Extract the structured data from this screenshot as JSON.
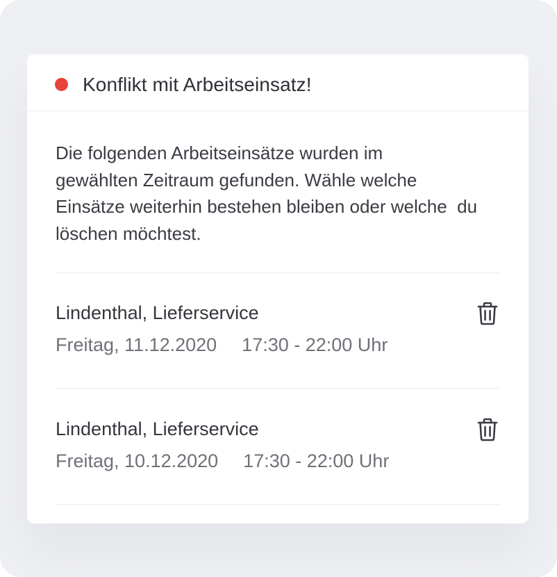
{
  "dialog": {
    "title": "Konflikt mit Arbeitseinsatz!",
    "status_color": "#e8443a",
    "intro": "Die folgenden Arbeitseinsätze wurden im\ngewählten Zeitraum gefunden. Wähle welche\nEinsätze weiterhin bestehen bleiben oder welche  du\nlöschen möchtest."
  },
  "assignments": [
    {
      "title": "Lindenthal, Lieferservice",
      "date": "Freitag, 11.12.2020",
      "time": "17:30 - 22:00 Uhr",
      "delete_icon": "trash-icon"
    },
    {
      "title": "Lindenthal, Lieferservice",
      "date": "Freitag, 10.12.2020",
      "time": "17:30 - 22:00 Uhr",
      "delete_icon": "trash-icon"
    }
  ]
}
